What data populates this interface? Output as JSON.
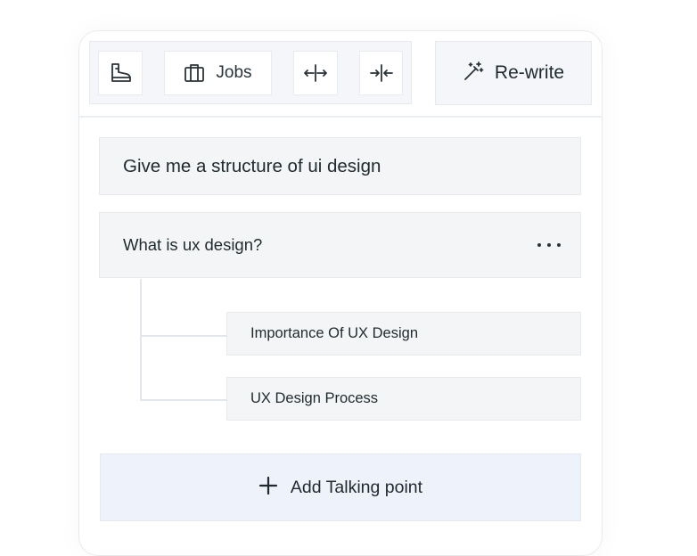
{
  "toolbar": {
    "icons": [
      "boot-icon",
      "briefcase-icon",
      "expand-horizontal-icon",
      "collapse-horizontal-icon",
      "magic-wand-icon"
    ],
    "jobs_label": "Jobs",
    "rewrite_label": "Re-write"
  },
  "outline": {
    "prompt": "Give me a structure of ui design",
    "heading": "What is ux design?",
    "subpoints": [
      "Importance Of UX Design",
      "UX Design Process"
    ],
    "add_label": "Add Talking point"
  },
  "colors": {
    "accent_bg": "#eef2fb",
    "toolbar_bg": "#f4f6f9",
    "block_bg": "#f4f5f6",
    "text": "#1f2a2e"
  }
}
